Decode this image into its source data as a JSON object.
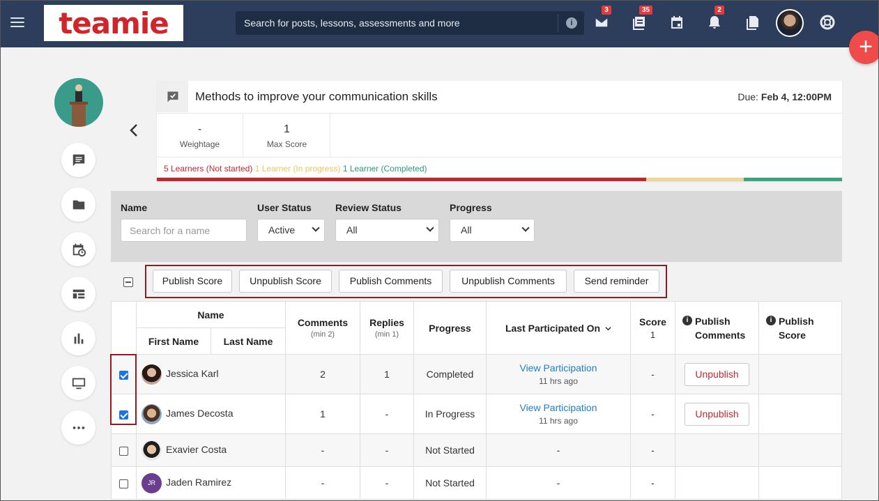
{
  "topbar": {
    "logo": "teamie",
    "search_placeholder": "Search for posts, lessons, assessments and more",
    "search_info": "i",
    "badges": {
      "messages": "3",
      "posts": "35",
      "notifications": "2"
    },
    "fab_label": "+"
  },
  "assessment": {
    "title": "Methods to improve your communication skills",
    "due_label": "Due:",
    "due_value": "Feb 4, 12:00PM",
    "stats": [
      {
        "value": "-",
        "label": "Weightage"
      },
      {
        "value": "1",
        "label": "Max Score"
      }
    ],
    "legend": {
      "not_started": "5 Learners (Not started)",
      "in_progress": "1 Learner (In progress)",
      "completed": "1 Learner (Completed)"
    },
    "progress_fractions": {
      "not_started": 0.714,
      "in_progress": 0.143,
      "completed": 0.143
    },
    "colors": {
      "not_started": "#c0282f",
      "in_progress": "#efd49a",
      "completed": "#3aa37f"
    }
  },
  "filters": {
    "name_label": "Name",
    "name_placeholder": "Search for a name",
    "user_status_label": "User Status",
    "user_status_value": "Active",
    "review_status_label": "Review Status",
    "review_status_value": "All",
    "progress_label": "Progress",
    "progress_value": "All"
  },
  "actions": {
    "publish_score": "Publish Score",
    "unpublish_score": "Unpublish Score",
    "publish_comments": "Publish Comments",
    "unpublish_comments": "Unpublish Comments",
    "send_reminder": "Send reminder"
  },
  "table": {
    "headers": {
      "name": "Name",
      "first_name": "First Name",
      "last_name": "Last Name",
      "comments": "Comments",
      "comments_sub": "(min 2)",
      "replies": "Replies",
      "replies_sub": "(min 1)",
      "progress": "Progress",
      "last_participated": "Last Participated On",
      "score": "Score",
      "score_sub": "1",
      "publish_comments_1": "Publish",
      "publish_comments_2": "Comments",
      "publish_score_1": "Publish",
      "publish_score_2": "Score"
    },
    "rows": [
      {
        "name": "Jessica Karl",
        "comments": "2",
        "replies": "1",
        "progress": "Completed",
        "link": "View Participation",
        "ago": "11 hrs ago",
        "score": "-",
        "action": "Unpublish"
      },
      {
        "name": "James Decosta",
        "comments": "1",
        "replies": "-",
        "progress": "In Progress",
        "link": "View Participation",
        "ago": "11 hrs ago",
        "score": "-",
        "action": "Unpublish"
      },
      {
        "name": "Exavier Costa",
        "comments": "-",
        "replies": "-",
        "progress": "Not Started",
        "last": "-",
        "score": "-"
      },
      {
        "name": "Jaden Ramirez",
        "initials": "JR",
        "comments": "-",
        "replies": "-",
        "progress": "Not Started",
        "last": "-",
        "score": "-"
      }
    ]
  }
}
